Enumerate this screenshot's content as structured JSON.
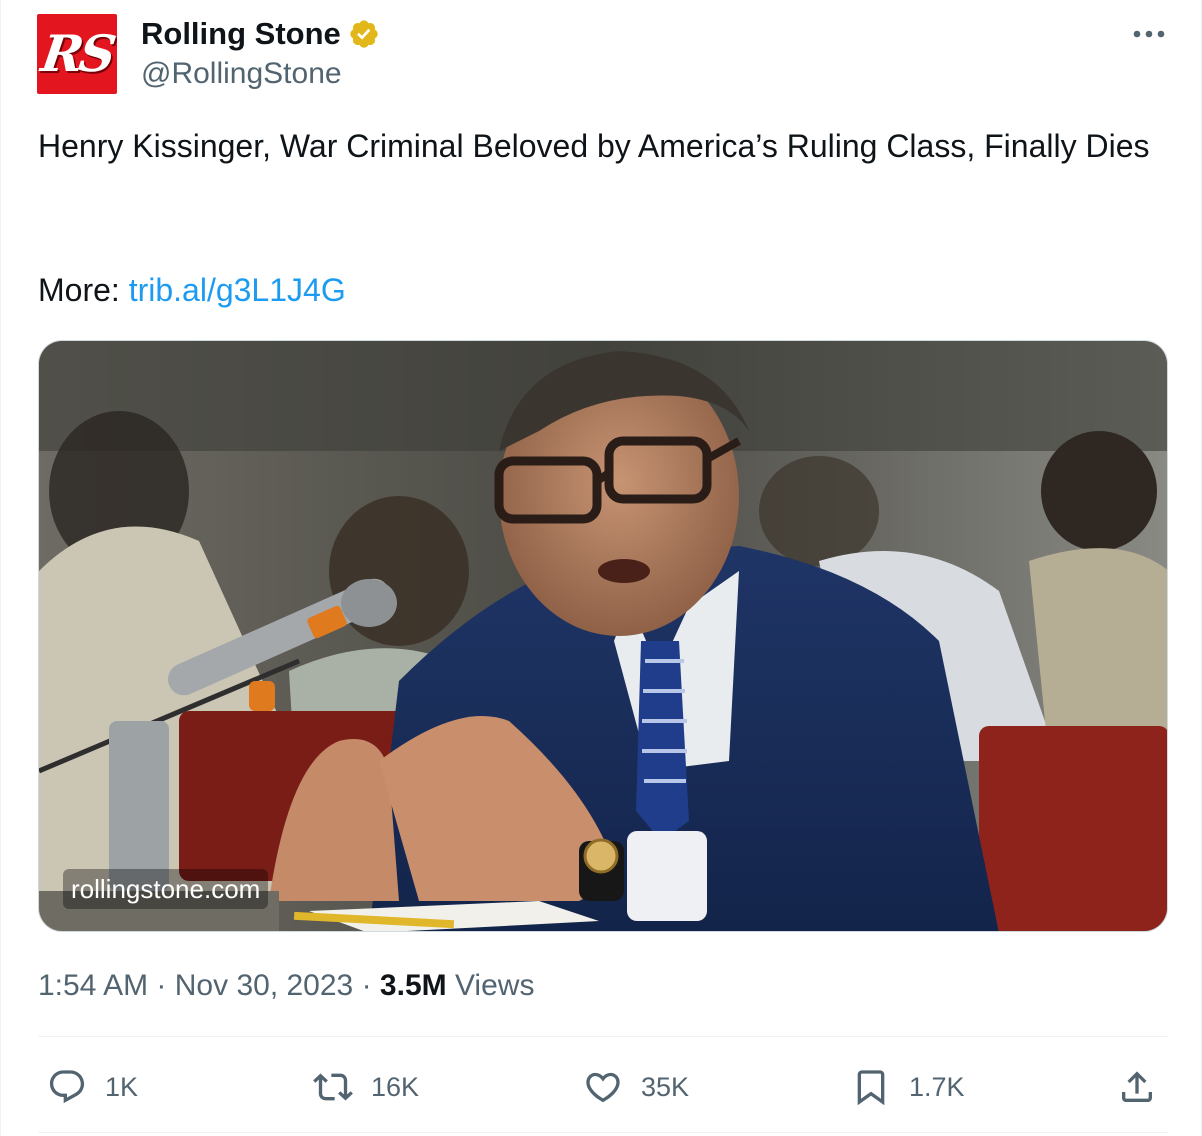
{
  "author": {
    "display_name": "Rolling Stone",
    "handle": "@RollingStone",
    "avatar_text": "RS",
    "verified_icon": "verified-badge-icon",
    "verified_color": "#e2b719"
  },
  "more_icon": "more-options-icon",
  "tweet": {
    "headline": "Henry Kissinger, War Criminal Beloved by America’s Ruling Class, Finally Dies",
    "more_label": "More:",
    "link_text": "trib.al/g3L1J4G"
  },
  "media": {
    "source_label": "rollingstone.com"
  },
  "meta": {
    "time": "1:54 AM",
    "separator": "·",
    "date": "Nov 30, 2023",
    "views_count": "3.5M",
    "views_label": "Views"
  },
  "actions": {
    "reply": {
      "icon": "reply-icon",
      "count": "1K"
    },
    "repost": {
      "icon": "repost-icon",
      "count": "16K"
    },
    "like": {
      "icon": "heart-icon",
      "count": "35K"
    },
    "bookmark": {
      "icon": "bookmark-icon",
      "count": "1.7K"
    },
    "share": {
      "icon": "share-icon"
    }
  },
  "colors": {
    "link": "#1d9bf0",
    "secondary_text": "#536471",
    "primary_text": "#0f1419",
    "brand_red": "#e3151f"
  }
}
